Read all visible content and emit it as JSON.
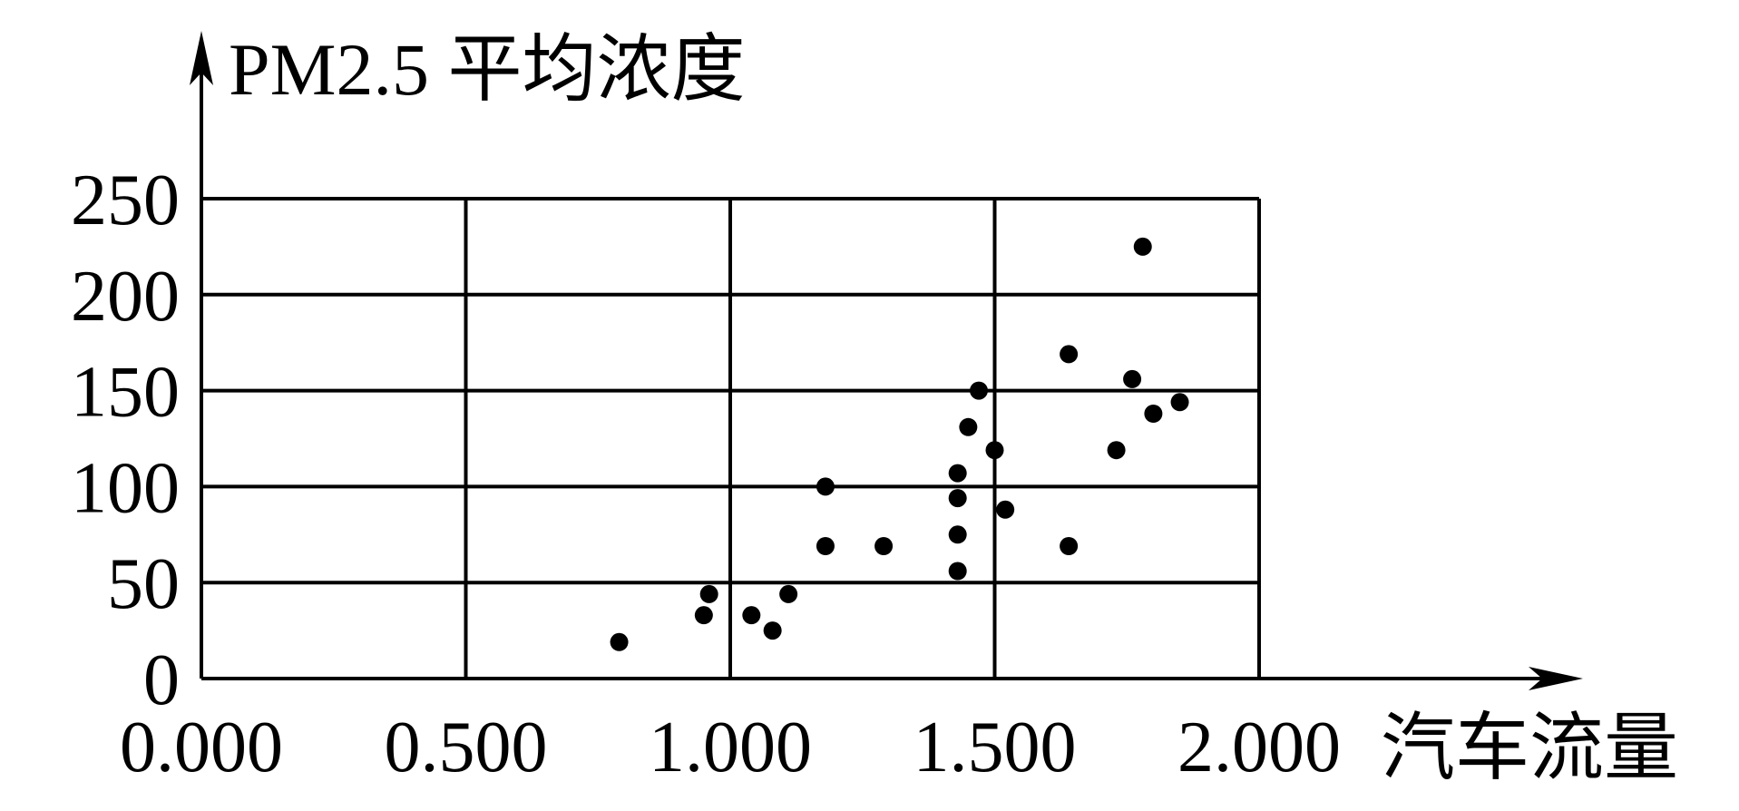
{
  "chart_data": {
    "type": "scatter",
    "title": "",
    "xlabel": "汽车流量",
    "ylabel": "PM2.5 平均浓度",
    "xlim": [
      0,
      2
    ],
    "ylim": [
      0,
      250
    ],
    "grid": true,
    "x_ticks": [
      0,
      0.5,
      1,
      1.5,
      2
    ],
    "x_tick_labels": [
      "0.000",
      "0.500",
      "1.000",
      "1.500",
      "2.000"
    ],
    "y_ticks": [
      0,
      50,
      100,
      150,
      200,
      250
    ],
    "y_tick_labels": [
      "0",
      "50",
      "100",
      "150",
      "200",
      "250"
    ],
    "series": [
      {
        "points": [
          [
            0.79,
            19
          ],
          [
            0.95,
            33
          ],
          [
            0.96,
            44
          ],
          [
            1.04,
            33
          ],
          [
            1.08,
            25
          ],
          [
            1.11,
            44
          ],
          [
            1.18,
            100
          ],
          [
            1.18,
            69
          ],
          [
            1.29,
            69
          ],
          [
            1.43,
            107
          ],
          [
            1.43,
            94
          ],
          [
            1.43,
            75
          ],
          [
            1.43,
            56
          ],
          [
            1.45,
            131
          ],
          [
            1.47,
            150
          ],
          [
            1.5,
            119
          ],
          [
            1.52,
            88
          ],
          [
            1.64,
            169
          ],
          [
            1.64,
            69
          ],
          [
            1.73,
            119
          ],
          [
            1.76,
            156
          ],
          [
            1.78,
            225
          ],
          [
            1.8,
            138
          ],
          [
            1.85,
            144
          ]
        ]
      }
    ],
    "colors": {
      "ink": "#000000",
      "background": "#ffffff"
    }
  }
}
